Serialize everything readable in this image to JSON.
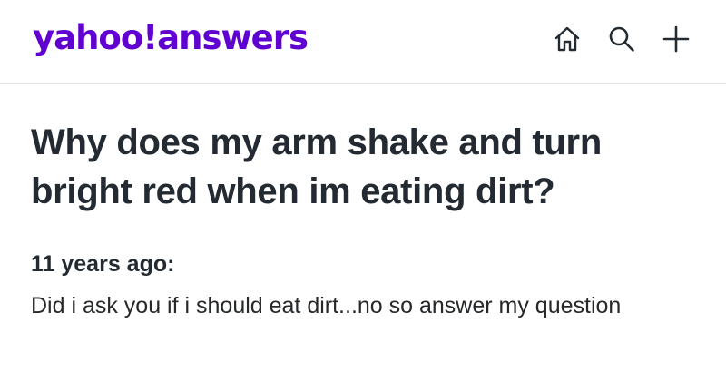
{
  "header": {
    "logo_yahoo": "yahoo!",
    "logo_answers": "answers",
    "icons": [
      "home-icon",
      "search-icon",
      "plus-icon"
    ]
  },
  "question": {
    "title": "Why does my arm shake and turn bright red when im eating dirt?"
  },
  "answer": {
    "time": "11 years ago:",
    "text": "Did i ask you if i should eat dirt...no so answer my question"
  },
  "colors": {
    "brand": "#6001d2",
    "text": "#232a31",
    "divider": "#e6e6e6"
  }
}
